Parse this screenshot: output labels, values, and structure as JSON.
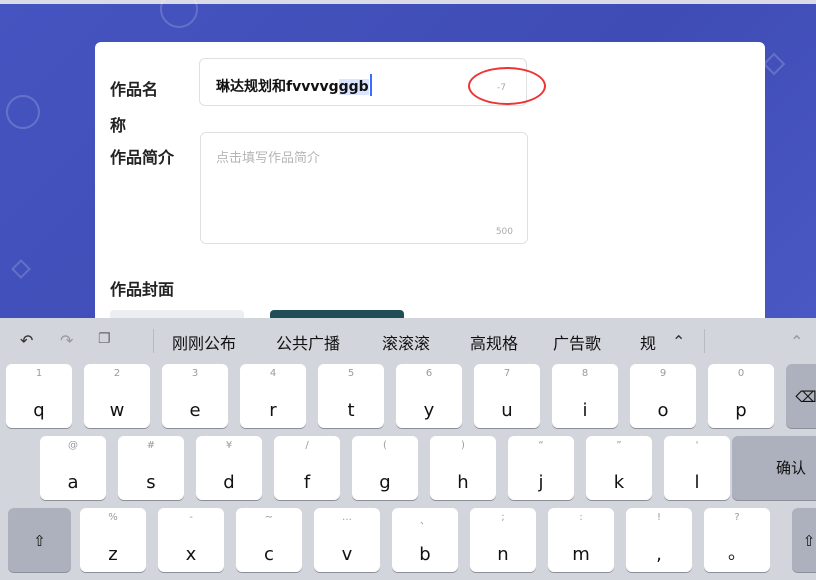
{
  "form": {
    "name_label": "作品名称",
    "name_value_plain": "琳达规划和fvvvvg",
    "name_value_selected": "ggb",
    "name_counter": "-7",
    "desc_label": "作品简介",
    "desc_placeholder": "点击填写作品简介",
    "desc_max": "500",
    "cover_label": "作品封面"
  },
  "keyboard": {
    "toolbar": {
      "undo_icon": "undo-icon",
      "redo_icon": "redo-icon",
      "clipboard_icon": "clipboard-icon",
      "expand_icon": "chevron-up-icon",
      "collapse_icon": "chevron-up-icon"
    },
    "candidates": [
      "刚刚公布",
      "公共广播",
      "滚滚滚",
      "高规格",
      "广告歌",
      "规"
    ],
    "row1": [
      {
        "sub": "1",
        "main": "q"
      },
      {
        "sub": "2",
        "main": "w"
      },
      {
        "sub": "3",
        "main": "e"
      },
      {
        "sub": "4",
        "main": "r"
      },
      {
        "sub": "5",
        "main": "t"
      },
      {
        "sub": "6",
        "main": "y"
      },
      {
        "sub": "7",
        "main": "u"
      },
      {
        "sub": "8",
        "main": "i"
      },
      {
        "sub": "9",
        "main": "o"
      },
      {
        "sub": "0",
        "main": "p"
      }
    ],
    "row2": [
      {
        "sub": "@",
        "main": "a"
      },
      {
        "sub": "#",
        "main": "s"
      },
      {
        "sub": "¥",
        "main": "d"
      },
      {
        "sub": "/",
        "main": "f"
      },
      {
        "sub": "(",
        "main": "g"
      },
      {
        "sub": ")",
        "main": "h"
      },
      {
        "sub": "“",
        "main": "j"
      },
      {
        "sub": "”",
        "main": "k"
      },
      {
        "sub": "'",
        "main": "l"
      }
    ],
    "confirm_label": "确认",
    "row3": [
      {
        "sub": "%",
        "main": "z"
      },
      {
        "sub": "-",
        "main": "x"
      },
      {
        "sub": "~",
        "main": "c"
      },
      {
        "sub": "…",
        "main": "v"
      },
      {
        "sub": "、",
        "main": "b"
      },
      {
        "sub": ";",
        "main": "n"
      },
      {
        "sub": ":",
        "main": "m"
      },
      {
        "sub": "!",
        "main": ","
      },
      {
        "sub": "?",
        "main": "。"
      }
    ],
    "shift_icon": "shift-icon",
    "backspace_icon": "backspace-icon"
  }
}
